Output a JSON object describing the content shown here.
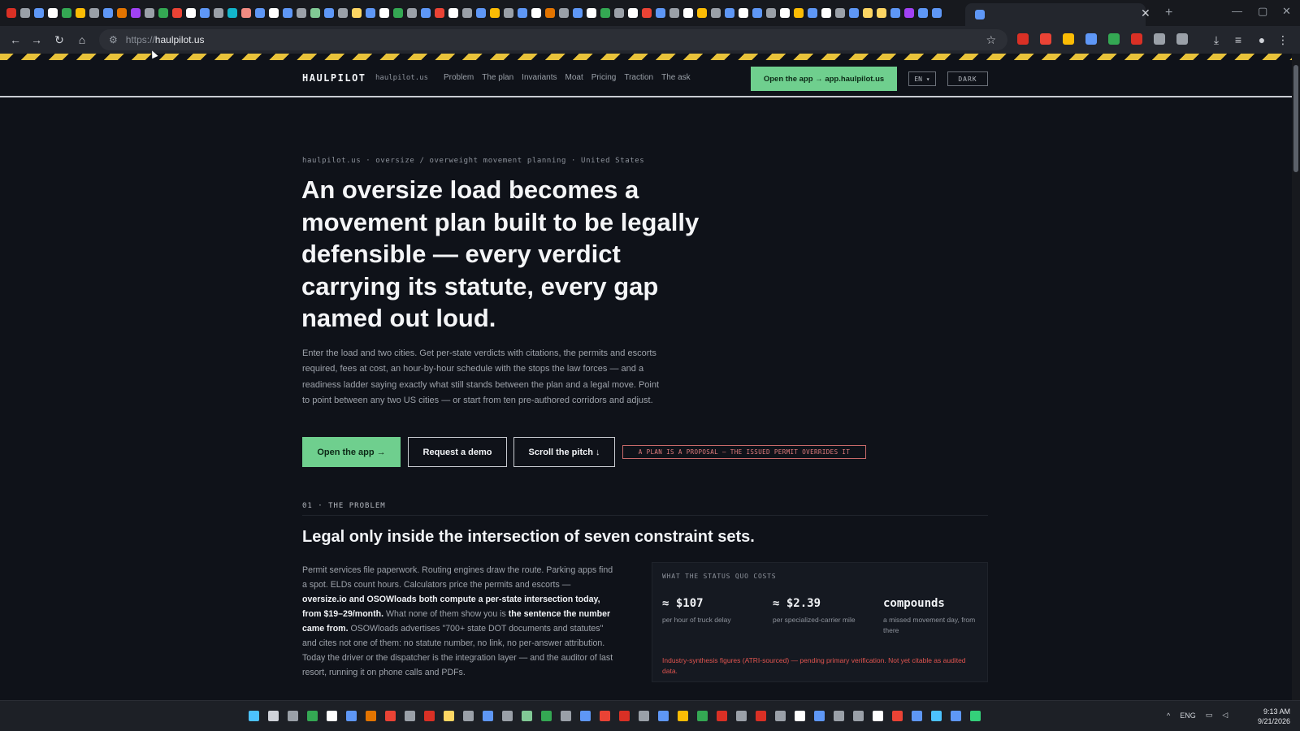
{
  "browser": {
    "url_scheme": "https://",
    "url_host": "haulpilot.us",
    "tab_favicon_colors": [
      "#d93025",
      "#9aa0a8",
      "#5e97f6",
      "#ffffff",
      "#34a853",
      "#fbbc05",
      "#9aa0a8",
      "#5e97f6",
      "#e37400",
      "#a142f4",
      "#9aa0a8",
      "#34a853",
      "#ea4335",
      "#ffffff",
      "#5e97f6",
      "#9aa0a8",
      "#12b5cb",
      "#f28b82",
      "#5e97f6",
      "#ffffff",
      "#5e97f6",
      "#9aa0a8",
      "#81c995",
      "#5e97f6",
      "#9aa0a8",
      "#fdd663",
      "#5e97f6",
      "#ffffff",
      "#34a853",
      "#9aa0a8",
      "#5e97f6",
      "#ea4335",
      "#ffffff",
      "#9aa0a8",
      "#5e97f6",
      "#fbbc05",
      "#9aa0a8",
      "#5e97f6",
      "#ffffff",
      "#e37400",
      "#9aa0a8",
      "#5e97f6",
      "#ffffff",
      "#34a853",
      "#9aa0a8",
      "#ffffff",
      "#ea4335",
      "#5e97f6",
      "#9aa0a8",
      "#ffffff",
      "#fbbc05",
      "#9aa0a8",
      "#5e97f6",
      "#ffffff",
      "#5e97f6",
      "#9aa0a8",
      "#ffffff",
      "#fbbc05",
      "#5e97f6",
      "#ffffff",
      "#9aa0a8",
      "#5e97f6",
      "#fdd663",
      "#fdd663",
      "#5e97f6",
      "#a142f4",
      "#5e97f6",
      "#5e97f6"
    ],
    "extension_colors": [
      "#d93025",
      "#ea4335",
      "#fbbc05",
      "#5e97f6",
      "#34a853",
      "#d93025",
      "#9aa0a8",
      "#9aa0a8"
    ]
  },
  "header": {
    "brand": "HAULPILOT",
    "domain": "haulpilot.us",
    "nav": [
      "Problem",
      "The plan",
      "Invariants",
      "Moat",
      "Pricing",
      "Traction",
      "The ask"
    ],
    "cta": "Open the app → app.haulpilot.us",
    "lang": "EN ▾",
    "theme": "DARK"
  },
  "hero": {
    "eyebrow": "haulpilot.us · oversize / overweight movement planning · United States",
    "title": "An oversize load becomes a movement plan built to be legally defensible — every verdict carrying its statute, every gap named out loud.",
    "body": "Enter the load and two cities. Get per-state verdicts with citations, the permits and escorts required, fees at cost, an hour-by-hour schedule with the stops the law forces — and a readiness ladder saying exactly what still stands between the plan and a legal move. Point to point between any two US cities — or start from ten pre-authored corridors and adjust.",
    "btn_open": "Open the app →",
    "btn_demo": "Request a demo",
    "btn_scroll": "Scroll the pitch ↓",
    "disclaimer": "A PLAN IS A PROPOSAL — THE ISSUED PERMIT OVERRIDES IT"
  },
  "problem": {
    "label": "01 · THE PROBLEM",
    "title": "Legal only inside the intersection of seven constraint sets.",
    "body_1": "Permit services file paperwork. Routing engines draw the route. Parking apps find a spot. ELDs count hours. Calculators price the permits and escorts — ",
    "body_bold_1": "oversize.io and OSOWloads both compute a per-state intersection today, from $19–29/month.",
    "body_2": " What none of them show you is ",
    "body_bold_2": "the sentence the number came from.",
    "body_3": " OSOWloads advertises \"700+ state DOT documents and statutes\" and cites not one of them: no statute number, no link, no per-answer attribution. Today the driver or the dispatcher is the integration layer — and the auditor of last resort, running it on phone calls and PDFs."
  },
  "costs": {
    "label": "WHAT THE STATUS QUO COSTS",
    "stats": [
      {
        "value": "≈ $107",
        "desc": "per hour of truck delay"
      },
      {
        "value": "≈ $2.39",
        "desc": "per specialized-carrier mile"
      },
      {
        "value": "compounds",
        "desc": "a missed movement day, from there"
      }
    ],
    "note": "Industry-synthesis figures (ATRI-sourced) — pending primary verification. Not yet citable as audited data."
  },
  "taskbar": {
    "icon_colors": [
      "#4cc2ff",
      "#cfd2d8",
      "#9aa0a8",
      "#34a853",
      "#ffffff",
      "#5e97f6",
      "#e37400",
      "#ea4335",
      "#9aa0a8",
      "#d93025",
      "#fdd663",
      "#9aa0a8",
      "#5e97f6",
      "#9aa0a8",
      "#81c995",
      "#34a853",
      "#9aa0a8",
      "#5e97f6",
      "#ea4335",
      "#d93025",
      "#9aa0a8",
      "#5e97f6",
      "#fbbc05",
      "#34a853",
      "#d93025",
      "#9aa0a8",
      "#d93025",
      "#9aa0a8",
      "#ffffff",
      "#5e97f6",
      "#9aa0a8",
      "#9aa0a8",
      "#ffffff",
      "#ea4335",
      "#5e97f6",
      "#4cc2ff",
      "#5e97f6",
      "#34d07a"
    ],
    "lang": "ENG",
    "time": "9:13 AM",
    "date": "9/21/2026"
  }
}
